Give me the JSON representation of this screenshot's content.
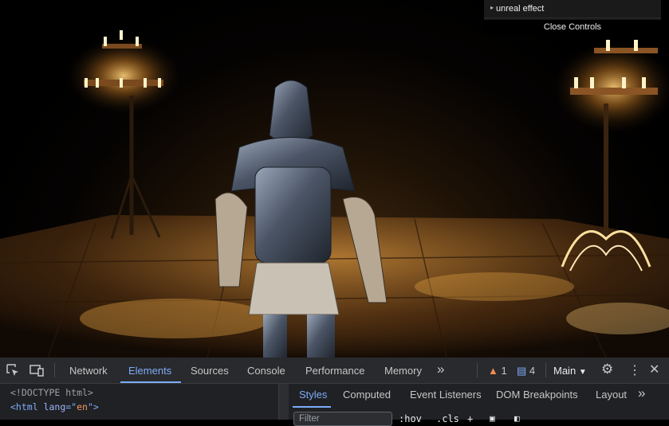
{
  "gui_controls": {
    "folder_label": "unreal effect",
    "close_label": "Close Controls"
  },
  "devtools": {
    "tabs": [
      "Network",
      "Elements",
      "Sources",
      "Console",
      "Performance",
      "Memory"
    ],
    "active_tab": "Elements",
    "more_tabs": "»",
    "warnings_count": "1",
    "messages_count": "4",
    "context_select": "Main",
    "elements": {
      "doctype": "<!DOCTYPE html>",
      "html_tag_open": "<html",
      "html_attr_name": " lang",
      "html_attr_eq": "=\"",
      "html_attr_value": "en",
      "html_tag_close": "\">"
    },
    "styles": {
      "subtabs": [
        "Styles",
        "Computed",
        "Event Listeners",
        "DOM Breakpoints",
        "Layout"
      ],
      "active_subtab": "Styles",
      "more_subtabs": "»",
      "filter_placeholder": "Filter",
      "hov_label": ":hov",
      "cls_label": ".cls",
      "add_rule": "+"
    }
  }
}
